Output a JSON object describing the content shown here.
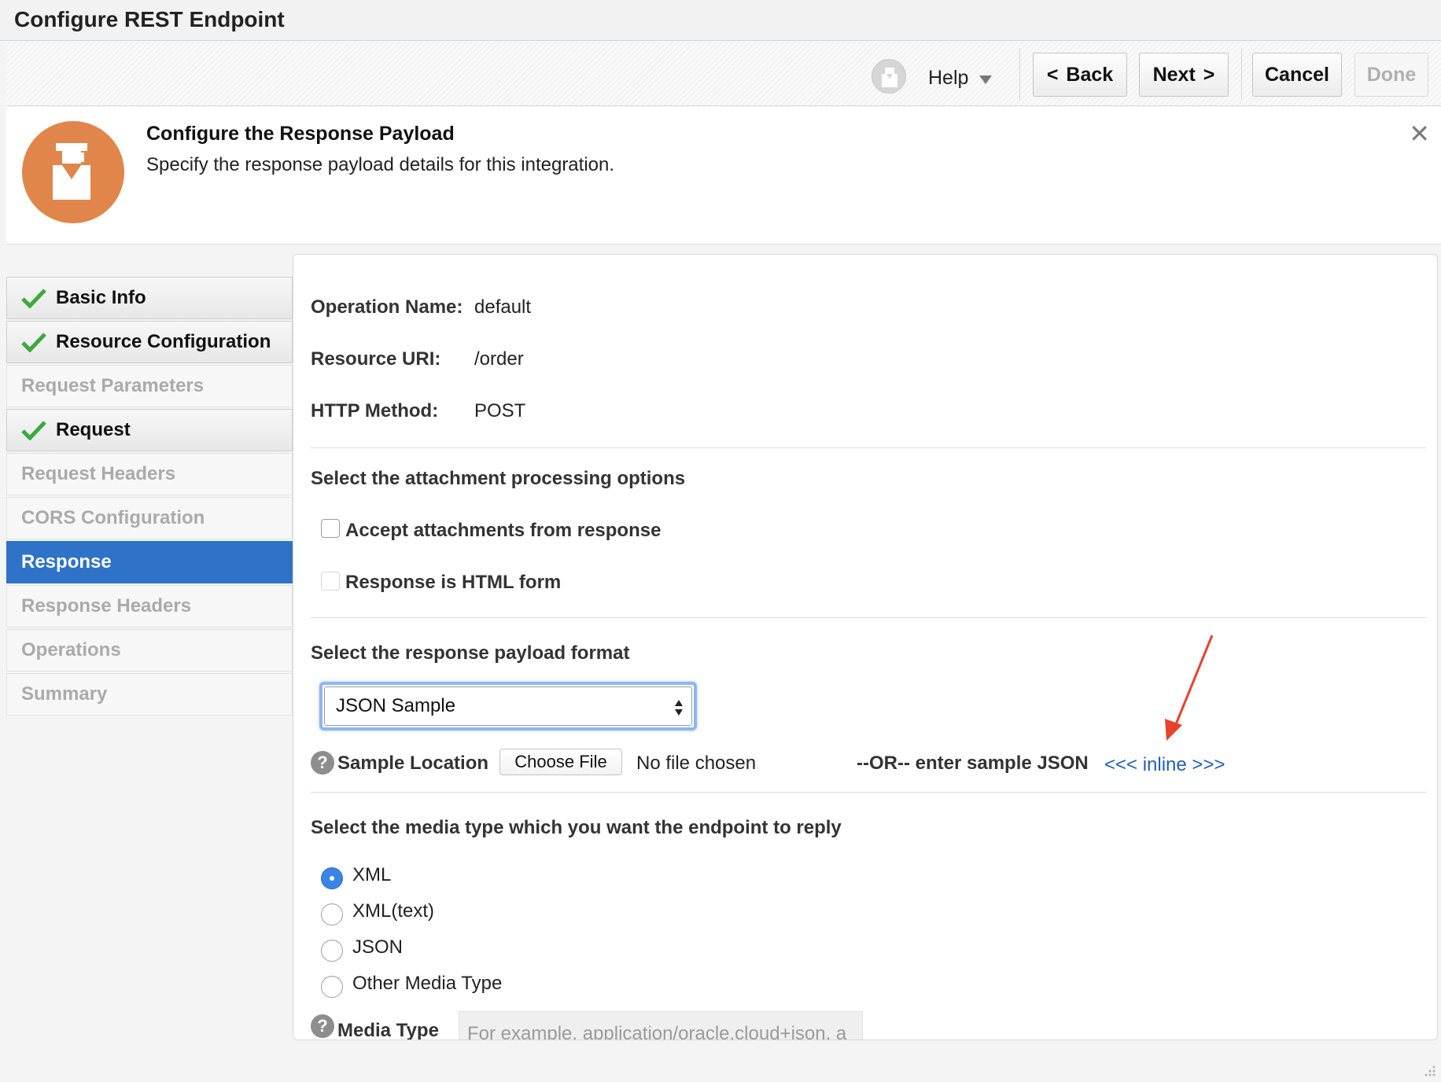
{
  "window": {
    "title": "Configure REST Endpoint"
  },
  "toolbar": {
    "help_label": "Help",
    "back_label": "Back",
    "back_prefix": "<",
    "next_label": "Next",
    "next_suffix": ">",
    "cancel_label": "Cancel",
    "done_label": "Done"
  },
  "guide": {
    "title": "Configure the Response Payload",
    "description": "Specify the response payload details for this integration.",
    "close_glyph": "✕"
  },
  "nav": {
    "items": [
      {
        "label": "Basic Info",
        "state": "done"
      },
      {
        "label": "Resource Configuration",
        "state": "done"
      },
      {
        "label": "Request Parameters",
        "state": "disabled"
      },
      {
        "label": "Request",
        "state": "done"
      },
      {
        "label": "Request Headers",
        "state": "disabled"
      },
      {
        "label": "CORS Configuration",
        "state": "disabled"
      },
      {
        "label": "Response",
        "state": "active"
      },
      {
        "label": "Response Headers",
        "state": "disabled"
      },
      {
        "label": "Operations",
        "state": "disabled"
      },
      {
        "label": "Summary",
        "state": "disabled"
      }
    ]
  },
  "summary": {
    "operation_name_label": "Operation Name:",
    "operation_name_value": "default",
    "resource_uri_label": "Resource URI:",
    "resource_uri_value": "/order",
    "http_method_label": "HTTP Method:",
    "http_method_value": "POST"
  },
  "attachments": {
    "section_title": "Select the attachment processing options",
    "accept_label": "Accept attachments from response",
    "html_form_label": "Response is HTML form"
  },
  "payload": {
    "section_title": "Select the response payload format",
    "format_selected": "JSON Sample",
    "sample_location_label": "Sample Location",
    "choose_file_label": "Choose File",
    "no_file_text": "No file chosen",
    "or_text": "--OR-- enter sample JSON",
    "inline_link": "<<< inline >>>"
  },
  "media": {
    "section_title": "Select the media type which you want the endpoint to reply",
    "options": [
      "XML",
      "XML(text)",
      "JSON",
      "Other Media Type"
    ],
    "selected": "XML",
    "media_type_label": "Media Type",
    "media_type_placeholder": "For example, application/oracle.cloud+json, a"
  },
  "colors": {
    "accent_blue": "#2f73c9",
    "guide_icon_orange": "#e0864a",
    "annotation_arrow": "#e5432d",
    "check_green": "#3da83b"
  }
}
